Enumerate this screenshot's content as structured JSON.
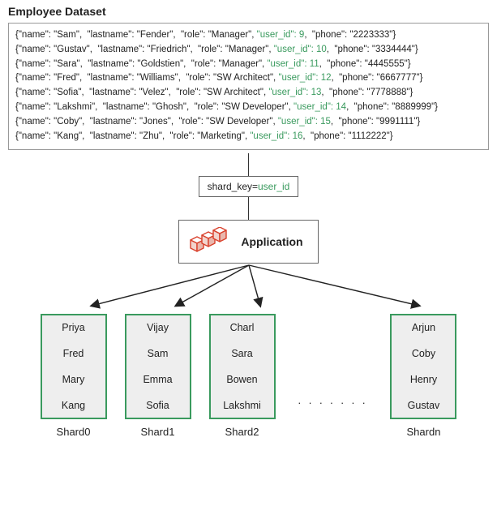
{
  "dataset": {
    "title": "Employee Dataset",
    "rows": [
      {
        "name": "Sam",
        "lastname": "Fender",
        "role": "Manager",
        "user_id": 9,
        "phone": "2223333"
      },
      {
        "name": "Gustav",
        "lastname": "Friedrich",
        "role": "Manager",
        "user_id": 10,
        "phone": "3334444"
      },
      {
        "name": "Sara",
        "lastname": "Goldstien",
        "role": "Manager",
        "user_id": 11,
        "phone": "4445555"
      },
      {
        "name": "Fred",
        "lastname": "Williams",
        "role": "SW Architect",
        "user_id": 12,
        "phone": "6667777"
      },
      {
        "name": "Sofia",
        "lastname": "Velez",
        "role": "SW Architect",
        "user_id": 13,
        "phone": "7778888"
      },
      {
        "name": "Lakshmi",
        "lastname": "Ghosh",
        "role": "SW Developer",
        "user_id": 14,
        "phone": "8889999"
      },
      {
        "name": "Coby",
        "lastname": "Jones",
        "role": "SW Developer",
        "user_id": 15,
        "phone": "9991111"
      },
      {
        "name": "Kang",
        "lastname": "Zhu",
        "role": "Marketing",
        "user_id": 16,
        "phone": "1112222"
      }
    ]
  },
  "shard_key": {
    "label": "shard_key=",
    "value": "user_id"
  },
  "application": {
    "label": "Application"
  },
  "ellipsis": ". . . . . . .",
  "shards": [
    {
      "label": "Shard0",
      "items": [
        "Priya",
        "Fred",
        "Mary",
        "Kang"
      ]
    },
    {
      "label": "Shard1",
      "items": [
        "Vijay",
        "Sam",
        "Emma",
        "Sofia"
      ]
    },
    {
      "label": "Shard2",
      "items": [
        "Charl",
        "Sara",
        "Bowen",
        "Lakshmi"
      ]
    },
    {
      "label": "Shardn",
      "items": [
        "Arjun",
        "Coby",
        "Henry",
        "Gustav"
      ]
    }
  ]
}
